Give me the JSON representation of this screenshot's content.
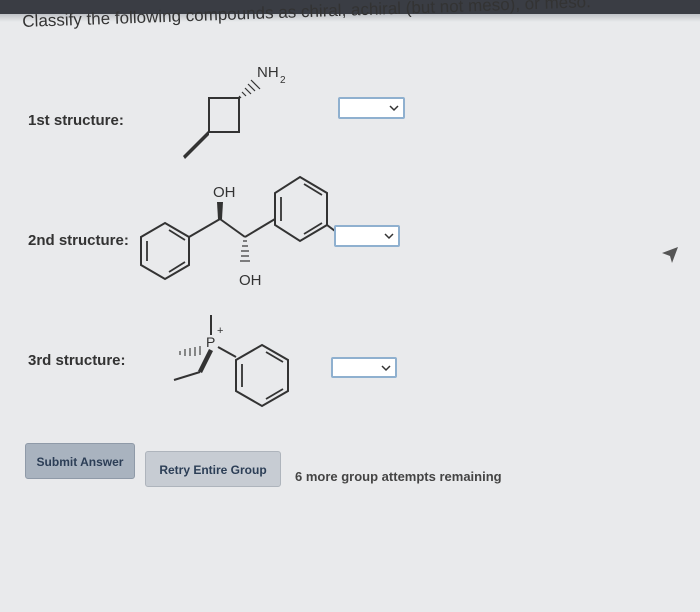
{
  "question": {
    "title": "Classify the following compounds as chiral, achiral (but not meso), or meso."
  },
  "structures": [
    {
      "label": "1st structure:",
      "group_label": "NH",
      "group_subscript": "2",
      "selected": ""
    },
    {
      "label": "2nd structure:",
      "group_top": "OH",
      "group_bottom": "OH",
      "selected": ""
    },
    {
      "label": "3rd structure:",
      "atom": "P",
      "charge": "+",
      "selected": ""
    }
  ],
  "buttons": {
    "submit": "Submit Answer",
    "retry": "Retry Entire Group"
  },
  "status": {
    "attempts": "6 more group attempts remaining"
  },
  "colors": {
    "select_border": "#8fb0cf",
    "submit_bg": "#a9b3bf",
    "retry_bg": "#c7ccd3"
  }
}
